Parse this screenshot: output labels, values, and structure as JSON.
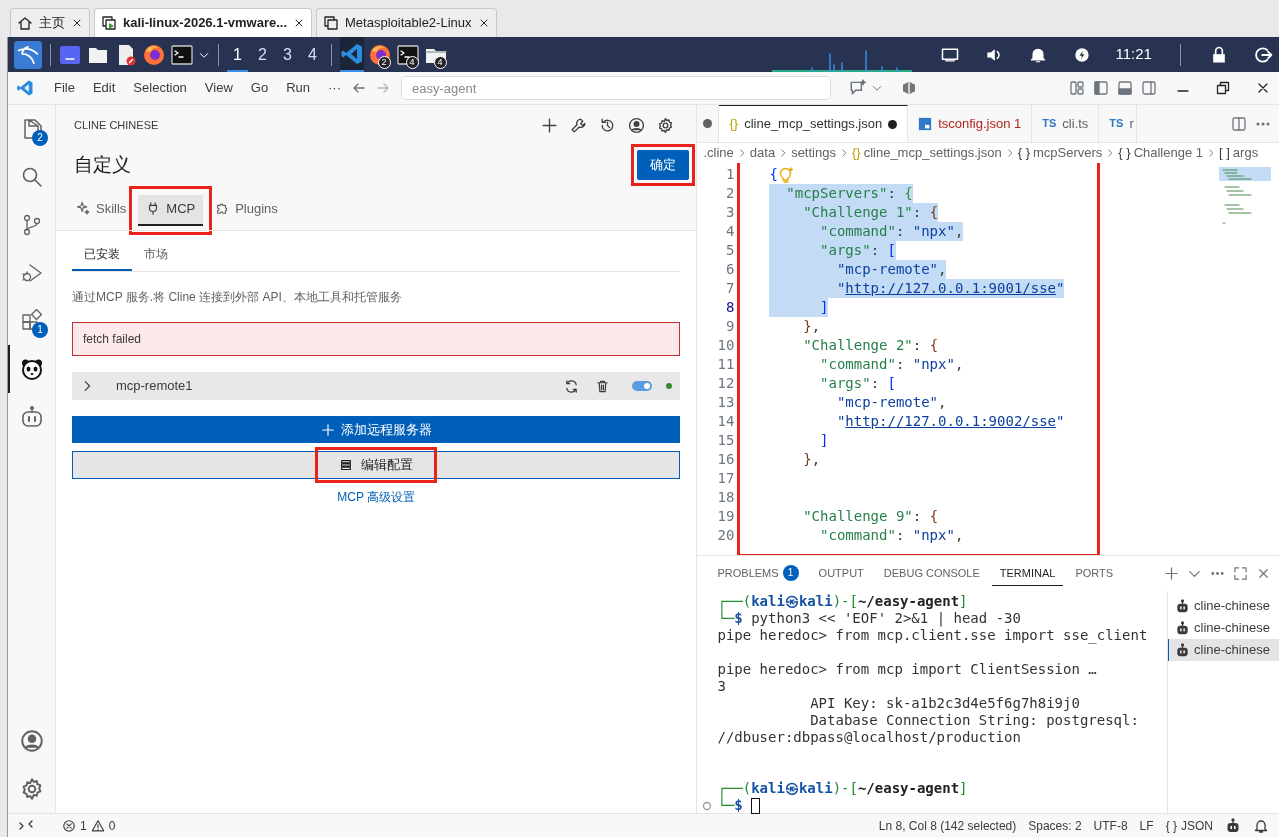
{
  "browser_tabs": [
    {
      "label": "主页",
      "kind": "home",
      "selected": false
    },
    {
      "label": "kali-linux-2026.1-vmware...",
      "kind": "vm",
      "selected": true
    },
    {
      "label": "Metasploitable2-Linux",
      "kind": "vm",
      "selected": false
    }
  ],
  "taskbar": {
    "workspaces": [
      {
        "label": "1",
        "selected": true
      },
      {
        "label": "2",
        "selected": false
      },
      {
        "label": "3",
        "selected": false
      },
      {
        "label": "4",
        "selected": false
      }
    ],
    "apps": [
      {
        "kind": "vscode",
        "selected": true
      },
      {
        "kind": "firefox",
        "badge": "2",
        "selected": false
      },
      {
        "kind": "terminal",
        "badge": "4",
        "selected": false
      },
      {
        "kind": "folder",
        "badge": "4",
        "selected": false
      }
    ],
    "clock": "11:21"
  },
  "menu": [
    "File",
    "Edit",
    "Selection",
    "View",
    "Go",
    "Run",
    "···"
  ],
  "command_center": {
    "placeholder": "easy-agent"
  },
  "activity_bar": [
    {
      "kind": "files",
      "badge": "2",
      "selected": false
    },
    {
      "kind": "search",
      "selected": false
    },
    {
      "kind": "branch",
      "selected": false
    },
    {
      "kind": "debug",
      "selected": false
    },
    {
      "kind": "extensions",
      "badge": "1",
      "selected": false
    },
    {
      "kind": "panda",
      "selected": true
    },
    {
      "kind": "robot",
      "selected": false
    }
  ],
  "sidebar": {
    "title": "CLINE CHINESE",
    "heading": "自定义",
    "confirm": {
      "label": "确定",
      "annotated": true
    },
    "tabs": [
      {
        "label": "Skills",
        "kind": "sparkle",
        "selected": false,
        "annotated": false
      },
      {
        "label": "MCP",
        "kind": "plug",
        "selected": true,
        "annotated": true
      },
      {
        "label": "Plugins",
        "kind": "puzzle",
        "selected": false,
        "annotated": false
      }
    ],
    "subtabs": [
      {
        "label": "已安装",
        "selected": true
      },
      {
        "label": "市场",
        "selected": false
      }
    ],
    "description": {
      "before": "通过",
      "link": "MCP",
      "after": " 服务.将 Cline 连接到外部 API、本地工具和托管服务"
    },
    "error": "fetch failed",
    "servers": [
      {
        "name": "mcp-remote1",
        "expanded": false,
        "enabled": true,
        "color": "#388a34"
      }
    ],
    "add_button": "添加远程服务器",
    "edit_button": {
      "label": "编辑配置",
      "annotated": true
    },
    "advanced_link": "MCP 高级设置"
  },
  "editor": {
    "tabs": [
      {
        "kind": "partial",
        "modified": true,
        "selected": false
      },
      {
        "kind": "json",
        "icon": "{}",
        "label": "cline_mcp_settings.json",
        "modified": true,
        "error": false,
        "selected": true
      },
      {
        "kind": "tsconfig",
        "label": "tsconfig.json 1",
        "modified": false,
        "error": true,
        "selected": false
      },
      {
        "kind": "ts",
        "icon": "TS",
        "label": "cli.ts",
        "modified": false,
        "error": false,
        "selected": false
      },
      {
        "kind": "ts",
        "icon": "TS",
        "label": "r",
        "modified": false,
        "error": false,
        "selected": false
      }
    ],
    "breadcrumbs": [
      {
        "label": ".cline"
      },
      {
        "label": "data"
      },
      {
        "label": "settings"
      },
      {
        "icon": "{}",
        "label": "cline_mcp_settings.json"
      },
      {
        "icon": "{ }",
        "label": "mcpServers"
      },
      {
        "icon": "{ }",
        "label": "Challenge 1"
      },
      {
        "icon": "[ ]",
        "label": "args"
      }
    ],
    "annotated": true,
    "lines": [
      {
        "number": "1",
        "lightbulb": true,
        "selected": false,
        "tokens": [
          {
            "text": "{",
            "kind": "b1"
          }
        ]
      },
      {
        "number": "2",
        "selected": true,
        "tokens": [
          {
            "text": "  \"mcpServers\"",
            "kind": "key"
          },
          {
            "text": ": ",
            "kind": "p"
          },
          {
            "text": "{",
            "kind": "b2"
          }
        ]
      },
      {
        "number": "3",
        "selected": true,
        "tokens": [
          {
            "text": "    \"Challenge 1\"",
            "kind": "key"
          },
          {
            "text": ": ",
            "kind": "p"
          },
          {
            "text": "{",
            "kind": "b3"
          }
        ]
      },
      {
        "number": "4",
        "selected": true,
        "tokens": [
          {
            "text": "      \"command\"",
            "kind": "key"
          },
          {
            "text": ": ",
            "kind": "p"
          },
          {
            "text": "\"npx\"",
            "kind": "str"
          },
          {
            "text": ",",
            "kind": "p"
          }
        ]
      },
      {
        "number": "5",
        "selected": true,
        "tokens": [
          {
            "text": "      \"args\"",
            "kind": "key"
          },
          {
            "text": ": ",
            "kind": "p"
          },
          {
            "text": "[",
            "kind": "b1"
          }
        ]
      },
      {
        "number": "6",
        "selected": true,
        "tokens": [
          {
            "text": "        \"mcp-remote\"",
            "kind": "str"
          },
          {
            "text": ",",
            "kind": "p"
          }
        ]
      },
      {
        "number": "7",
        "selected": true,
        "tokens": [
          {
            "text": "        \"",
            "kind": "str"
          },
          {
            "text": "http://127.0.0.1:9001/sse",
            "kind": "link"
          },
          {
            "text": "\"",
            "kind": "str"
          }
        ]
      },
      {
        "number": "8",
        "selected": true,
        "current": true,
        "tokens": [
          {
            "text": "      ]",
            "kind": "b1"
          }
        ]
      },
      {
        "number": "9",
        "selected": false,
        "tokens": [
          {
            "text": "    }",
            "kind": "b3"
          },
          {
            "text": ",",
            "kind": "p"
          }
        ]
      },
      {
        "number": "10",
        "selected": false,
        "tokens": [
          {
            "text": "    \"Challenge 2\"",
            "kind": "key"
          },
          {
            "text": ": ",
            "kind": "p"
          },
          {
            "text": "{",
            "kind": "b3"
          }
        ]
      },
      {
        "number": "11",
        "selected": false,
        "tokens": [
          {
            "text": "      \"command\"",
            "kind": "key"
          },
          {
            "text": ": ",
            "kind": "p"
          },
          {
            "text": "\"npx\"",
            "kind": "str"
          },
          {
            "text": ",",
            "kind": "p"
          }
        ]
      },
      {
        "number": "12",
        "selected": false,
        "tokens": [
          {
            "text": "      \"args\"",
            "kind": "key"
          },
          {
            "text": ": ",
            "kind": "p"
          },
          {
            "text": "[",
            "kind": "b1"
          }
        ]
      },
      {
        "number": "13",
        "selected": false,
        "tokens": [
          {
            "text": "        \"mcp-remote\"",
            "kind": "str"
          },
          {
            "text": ",",
            "kind": "p"
          }
        ]
      },
      {
        "number": "14",
        "selected": false,
        "tokens": [
          {
            "text": "        \"",
            "kind": "str"
          },
          {
            "text": "http://127.0.0.1:9002/sse",
            "kind": "link"
          },
          {
            "text": "\"",
            "kind": "str"
          }
        ]
      },
      {
        "number": "15",
        "selected": false,
        "tokens": [
          {
            "text": "      ]",
            "kind": "b1"
          }
        ]
      },
      {
        "number": "16",
        "selected": false,
        "tokens": [
          {
            "text": "    }",
            "kind": "b3"
          },
          {
            "text": ",",
            "kind": "p"
          }
        ]
      },
      {
        "number": "17"
      },
      {
        "number": "18"
      },
      {
        "number": "19",
        "selected": false,
        "tokens": [
          {
            "text": "    \"Challenge 9\"",
            "kind": "key"
          },
          {
            "text": ": ",
            "kind": "p"
          },
          {
            "text": "{",
            "kind": "b3"
          }
        ]
      },
      {
        "number": "20",
        "selected": false,
        "tokens": [
          {
            "text": "      \"command\"",
            "kind": "key"
          },
          {
            "text": ": ",
            "kind": "p"
          },
          {
            "text": "\"npx\"",
            "kind": "str"
          },
          {
            "text": ",",
            "kind": "p"
          }
        ]
      }
    ]
  },
  "panel": {
    "tabs": [
      {
        "label": "PROBLEMS",
        "badge": "1",
        "selected": false
      },
      {
        "label": "OUTPUT",
        "selected": false
      },
      {
        "label": "DEBUG CONSOLE",
        "selected": false
      },
      {
        "label": "TERMINAL",
        "selected": true
      },
      {
        "label": "PORTS",
        "selected": false
      }
    ],
    "terminal_lines": [
      {
        "tokens": [
          {
            "text": "┌──(",
            "kind": "g"
          },
          {
            "text": "kali㉿kali",
            "kind": "kb"
          },
          {
            "text": ")-[",
            "kind": "g"
          },
          {
            "text": "~/easy-agent",
            "kind": "pb"
          },
          {
            "text": "]",
            "kind": "g"
          }
        ]
      },
      {
        "tokens": [
          {
            "text": "└─",
            "kind": "g"
          },
          {
            "text": "$",
            "kind": "kb"
          },
          {
            "text": " python3 << 'EOF' 2>&1 | head -30",
            "kind": "t"
          }
        ]
      },
      {
        "tokens": [
          {
            "text": "pipe heredoc> from mcp.client.sse import sse_client",
            "kind": "t"
          }
        ]
      },
      {
        "kind": "blank"
      },
      {
        "tokens": [
          {
            "text": "pipe heredoc> from mcp import ClientSession …",
            "kind": "t"
          }
        ]
      },
      {
        "tokens": [
          {
            "text": "3",
            "kind": "t"
          }
        ]
      },
      {
        "tokens": [
          {
            "text": "           API Key: sk-a1b2c3d4e5f6g7h8i9j0",
            "kind": "t"
          }
        ]
      },
      {
        "tokens": [
          {
            "text": "           Database Connection String: postgresql:",
            "kind": "t"
          }
        ]
      },
      {
        "tokens": [
          {
            "text": "//dbuser:dbpass@localhost/production",
            "kind": "t"
          }
        ]
      },
      {
        "kind": "blank"
      },
      {
        "kind": "blank"
      },
      {
        "tokens": [
          {
            "text": "┌──(",
            "kind": "g"
          },
          {
            "text": "kali㉿kali",
            "kind": "kb"
          },
          {
            "text": ")-[",
            "kind": "g"
          },
          {
            "text": "~/easy-agent",
            "kind": "pb"
          },
          {
            "text": "]",
            "kind": "g"
          }
        ]
      },
      {
        "tokens": [
          {
            "text": "└─",
            "kind": "g"
          },
          {
            "text": "$",
            "kind": "kb"
          }
        ],
        "cursor": true,
        "decoration": true
      }
    ],
    "terminals": [
      {
        "label": "cline-chinese",
        "selected": false
      },
      {
        "label": "cline-chinese",
        "selected": false
      },
      {
        "label": "cline-chinese",
        "selected": true
      }
    ]
  },
  "status_bar": {
    "errors": "1",
    "warnings": "0",
    "position": "Ln 8, Col 8 (142 selected)",
    "indent": "Spaces: 2",
    "encoding": "UTF-8",
    "eol": "LF",
    "language_icon": "{ }",
    "language": "JSON"
  }
}
